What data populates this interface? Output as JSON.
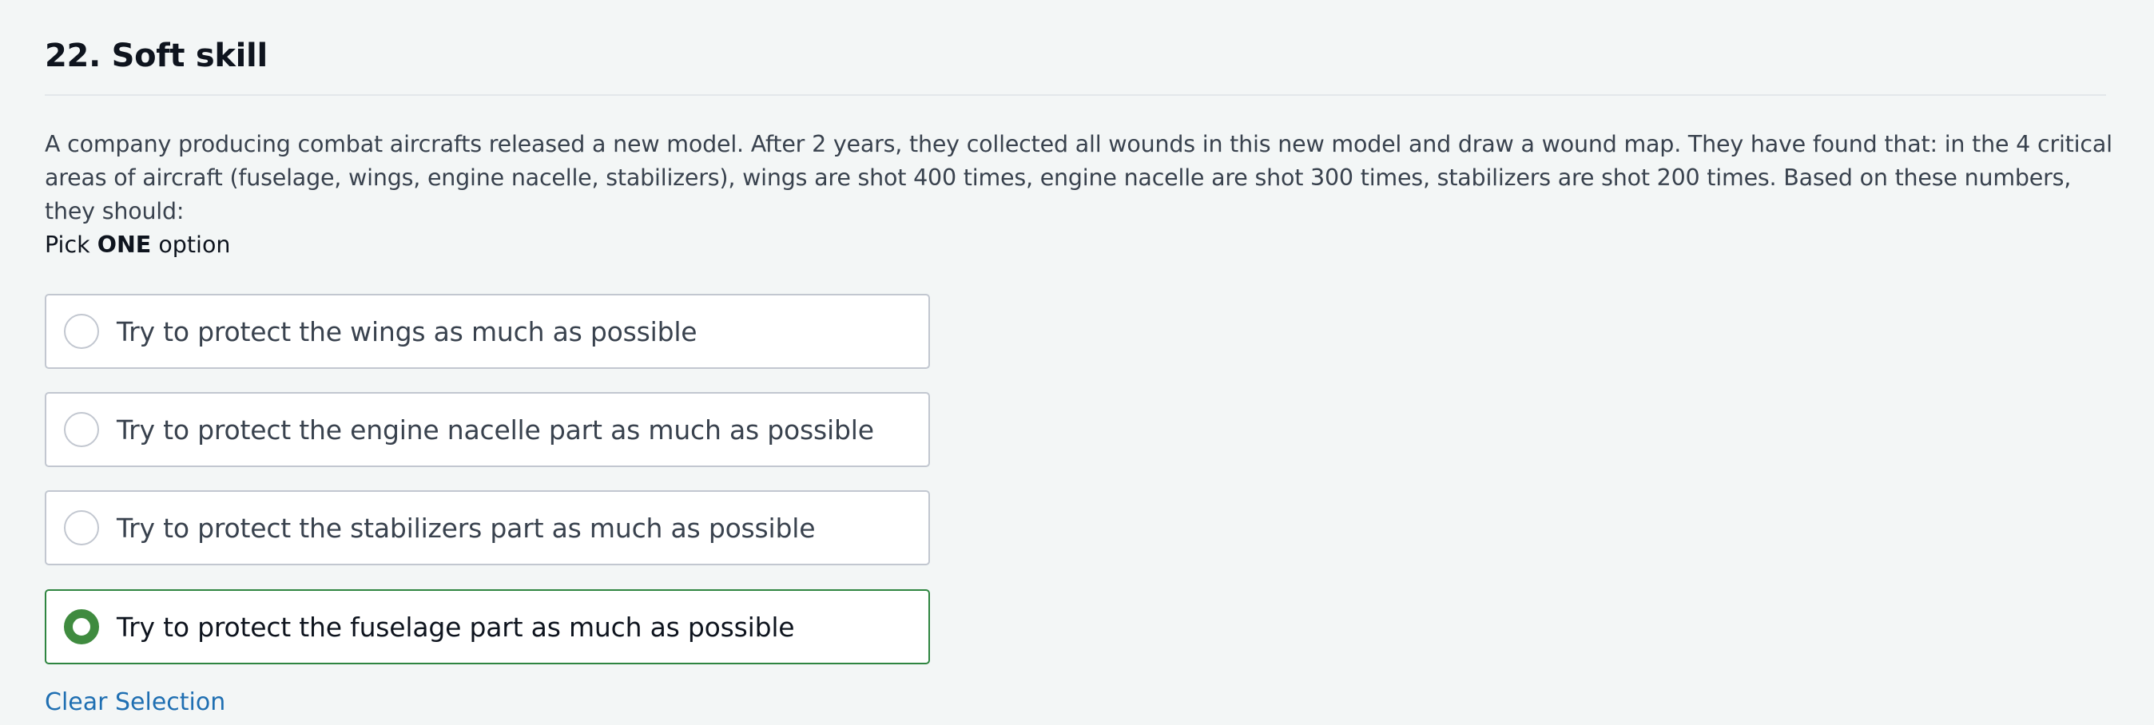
{
  "question": {
    "title": "22. Soft skill",
    "text": "A company producing combat aircrafts released a new model. After 2 years, they collected all wounds in this new model and draw a wound map. They have found that: in the 4 critical areas of aircraft (fuselage, wings, engine nacelle, stabilizers), wings are shot 400 times, engine nacelle are shot 300 times, stabilizers are shot 200 times. Based on these numbers, they should:",
    "pick_prefix": "Pick ",
    "pick_emphasis": "ONE",
    "pick_suffix": " option"
  },
  "options": [
    {
      "label": "Try to protect the wings as much as possible",
      "selected": false
    },
    {
      "label": "Try to protect the engine nacelle part as much as possible",
      "selected": false
    },
    {
      "label": "Try to protect the stabilizers part as much as possible",
      "selected": false
    },
    {
      "label": "Try to protect the fuselage part as much as possible",
      "selected": true
    }
  ],
  "actions": {
    "clear_label": "Clear Selection"
  },
  "colors": {
    "selected_accent": "#3f8b3f",
    "link": "#1f6fb2",
    "background": "#f3f6f6"
  }
}
